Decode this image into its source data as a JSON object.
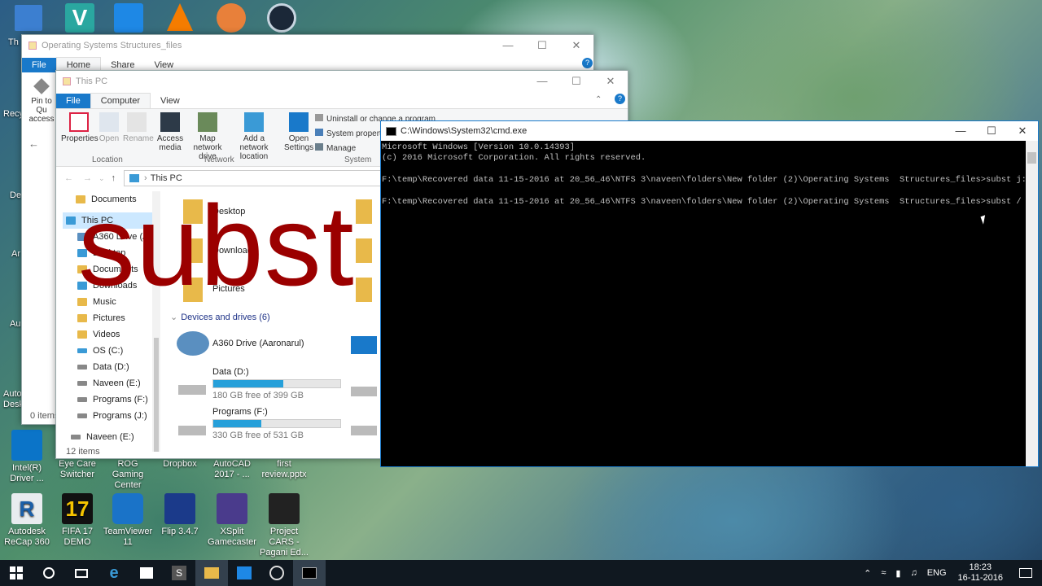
{
  "desktop": {
    "icons_top": [
      {
        "label": "Th",
        "color": "#3c7fd0"
      },
      {
        "label": "",
        "color": "#2aa7a0"
      },
      {
        "label": "",
        "color": "#1e88e5"
      },
      {
        "label": "",
        "color": "#f57c00"
      },
      {
        "label": "",
        "color": "#e8803a"
      },
      {
        "label": "",
        "color": "#1b2838"
      }
    ],
    "icons_left": [
      "Recy",
      "De",
      "Ar",
      "Au",
      "Autod Deskt",
      "Intel(R) Driver ..."
    ],
    "icons_row1": [
      "Eye Care Switcher",
      "ROG Gaming Center",
      "Dropbox",
      "AutoCAD 2017 - ...",
      "first review.pptx"
    ],
    "icons_row2": [
      {
        "label": "Autodesk ReCap 360",
        "color": "#e8ecef"
      },
      {
        "label": "FIFA 17 DEMO",
        "color": "#111111"
      },
      {
        "label": "TeamViewer 11",
        "color": "#1a73c8"
      },
      {
        "label": "Flip 3.4.7",
        "color": "#1b3a8a"
      },
      {
        "label": "XSplit Gamecaster",
        "color": "#4a3b8c"
      },
      {
        "label": "Project CARS - Pagani Ed...",
        "color": "#222222"
      }
    ]
  },
  "explorer_back": {
    "title": "Operating Systems  Structures_files",
    "tabs": [
      "File",
      "Home",
      "Share",
      "View"
    ],
    "pin_label": "Pin to Qu access",
    "status": "0 items"
  },
  "explorer_front": {
    "title": "This PC",
    "tabs": [
      "File",
      "Computer",
      "View"
    ],
    "ribbon": {
      "properties": "Properties",
      "open": "Open",
      "rename": "Rename",
      "access_media": "Access media",
      "map_drive": "Map network drive",
      "add_location": "Add a network location",
      "open_settings": "Open Settings",
      "uninstall": "Uninstall or change a program",
      "system_properties": "System propertie",
      "manage": "Manage",
      "group_location": "Location",
      "group_network": "Network",
      "group_system": "System"
    },
    "address": "This PC",
    "nav": {
      "documents": "Documents",
      "this_pc": "This PC",
      "a360": "A360 Drive (A",
      "desktop": "Desktop",
      "documents2": "Documents",
      "downloads": "Downloads",
      "music": "Music",
      "pictures": "Pictures",
      "videos": "Videos",
      "os": "OS (C:)",
      "data": "Data (D:)",
      "naveen": "Naveen (E:)",
      "programs_f": "Programs (F:)",
      "programs_j": "Programs (J:)",
      "naveen2": "Naveen (E:)"
    },
    "folders": {
      "desktop": "Desktop",
      "downloads": "Downloads",
      "pictures": "Pictures"
    },
    "devices_header": "Devices and drives (6)",
    "drives": [
      {
        "name": "A360 Drive (Aaronarul)",
        "free": "",
        "used_pct": null
      },
      {
        "name": "Data (D:)",
        "free": "180 GB free of 399 GB",
        "used_pct": 0.55
      },
      {
        "name": "Programs (F:)",
        "free": "330 GB free of 531 GB",
        "used_pct": 0.38
      }
    ],
    "status": "12 items"
  },
  "cmd": {
    "title": "C:\\Windows\\System32\\cmd.exe",
    "lines": [
      "Microsoft Windows [Version 10.0.14393]",
      "(c) 2016 Microsoft Corporation. All rights reserved.",
      "",
      "F:\\temp\\Recovered data 11-15-2016 at 20_56_46\\NTFS 3\\naveen\\folders\\New folder (2)\\Operating Systems  Structures_files>subst j: .",
      "",
      "F:\\temp\\Recovered data 11-15-2016 at 20_56_46\\NTFS 3\\naveen\\folders\\New folder (2)\\Operating Systems  Structures_files>subst /"
    ]
  },
  "overlay_text": "subst /d j:",
  "taskbar": {
    "lang": "ENG",
    "time": "18:23",
    "date": "16-11-2016"
  }
}
